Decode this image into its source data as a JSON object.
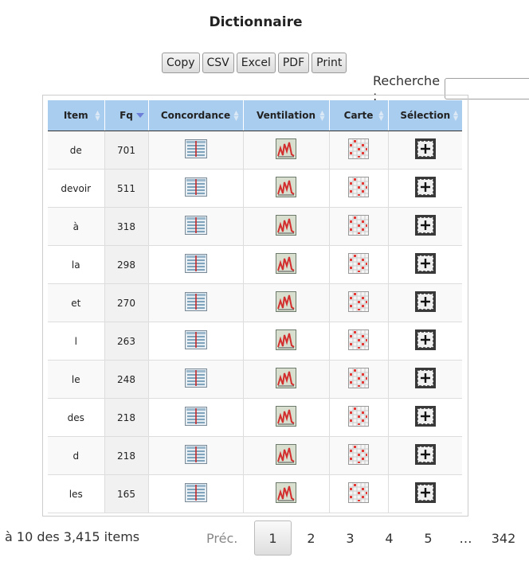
{
  "title": "Dictionnaire",
  "buttons": [
    "Copy",
    "CSV",
    "Excel",
    "PDF",
    "Print"
  ],
  "search": {
    "label": "Recherche :",
    "value": ""
  },
  "columns": [
    "Item",
    "Fq",
    "Concordance",
    "Ventilation",
    "Carte",
    "Sélection"
  ],
  "rows": [
    {
      "item": "de",
      "fq": "701"
    },
    {
      "item": "devoir",
      "fq": "511"
    },
    {
      "item": "à",
      "fq": "318"
    },
    {
      "item": "la",
      "fq": "298"
    },
    {
      "item": "et",
      "fq": "270"
    },
    {
      "item": "l",
      "fq": "263"
    },
    {
      "item": "le",
      "fq": "248"
    },
    {
      "item": "des",
      "fq": "218"
    },
    {
      "item": "d",
      "fq": "218"
    },
    {
      "item": "les",
      "fq": "165"
    }
  ],
  "footer": {
    "info": "à 10 des 3,415 items",
    "prev": "Préc.",
    "pages": [
      "1",
      "2",
      "3",
      "4",
      "5"
    ],
    "ellipsis": "…",
    "last": "342",
    "current": "1"
  },
  "icons": {
    "concordance": "concordance-icon",
    "ventilation": "ventilation-icon",
    "carte": "carte-icon",
    "selection": "selection-add-icon"
  }
}
